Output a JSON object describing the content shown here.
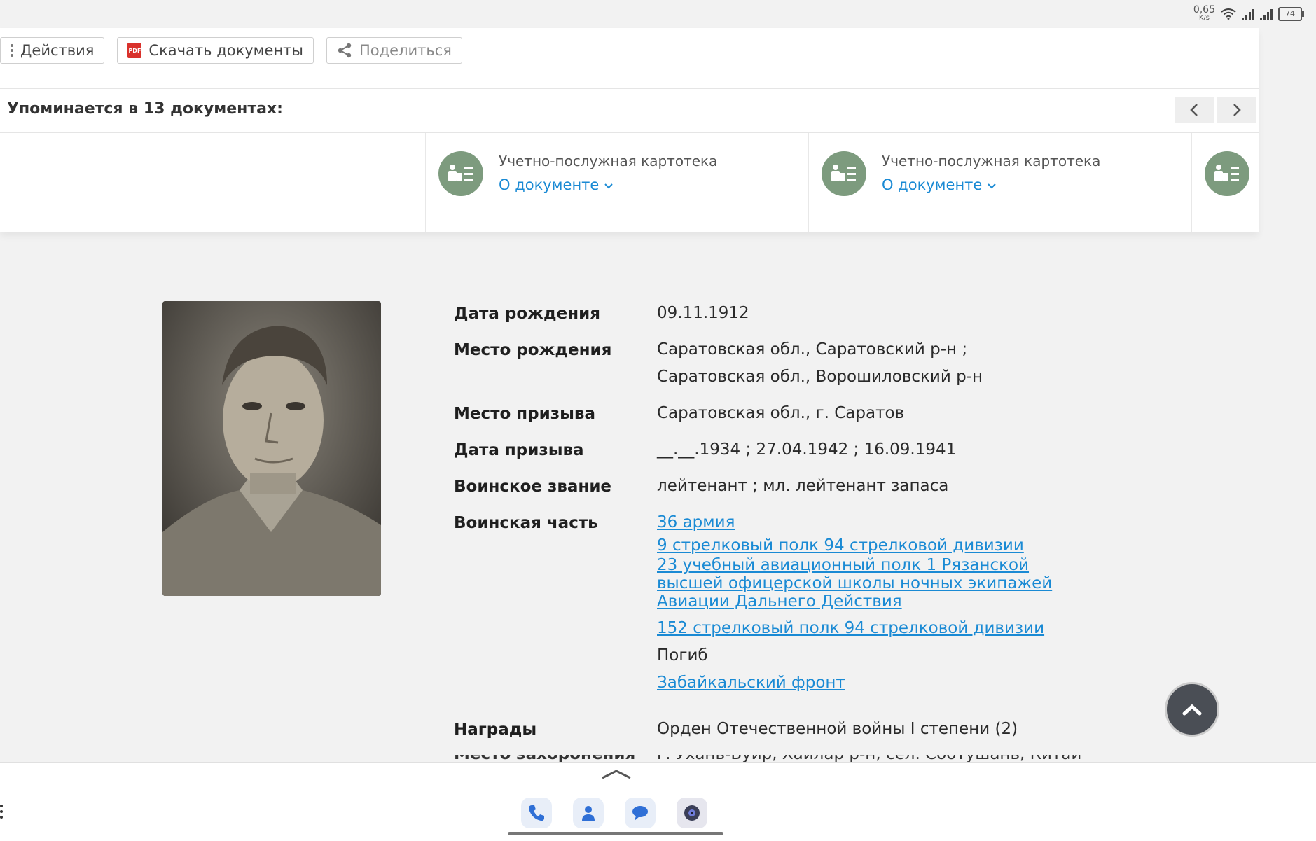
{
  "status": {
    "speed_value": "0,65",
    "speed_unit": "K/s",
    "battery": "74"
  },
  "toolbar": {
    "actions_label": "Действия",
    "download_label": "Скачать документы",
    "share_label": "Поделиться"
  },
  "mentions": {
    "title": "Упоминается в 13 документах:",
    "docs": [
      {
        "title": "Учетно-послужная картотека",
        "about": "О документе"
      },
      {
        "title": "Учетно-послужная картотека",
        "about": "О документе"
      }
    ]
  },
  "details": {
    "birth_date": {
      "label": "Дата рождения",
      "value": "09.11.1912"
    },
    "birth_place": {
      "label": "Место рождения",
      "value": "Саратовская обл., Саратовский р-н ; Саратовская обл., Ворошиловский р-н"
    },
    "draft_place": {
      "label": "Место призыва",
      "value": "Саратовская обл., г. Саратов"
    },
    "draft_date": {
      "label": "Дата призыва",
      "value": "__.__.1934 ; 27.04.1942 ; 16.09.1941"
    },
    "rank": {
      "label": "Воинское звание",
      "value": "лейтенант ; мл. лейтенант запаса"
    },
    "unit": {
      "label": "Воинская часть",
      "items": [
        "36 армия",
        "9 стрелковый полк 94 стрелковой дивизии",
        "23 учебный авиационный полк 1 Рязанской высшей офицерской школы ночных экипажей Авиации Дальнего Действия",
        "152 стрелковый полк 94 стрелковой дивизии",
        "Погиб",
        "Забайкальский фронт"
      ]
    },
    "awards": {
      "label": "Награды",
      "value": "Орден Отечественной войны I степени (2)"
    },
    "burial_place_partial": {
      "label": "Место захоронения",
      "value": "г. Ухань-Буир, Хайлар р-н, сел. Соотушань, Китай"
    }
  },
  "colors": {
    "link": "#1a8ad4",
    "doc_icon": "#7d9b7e",
    "pdf": "#d9312b"
  }
}
